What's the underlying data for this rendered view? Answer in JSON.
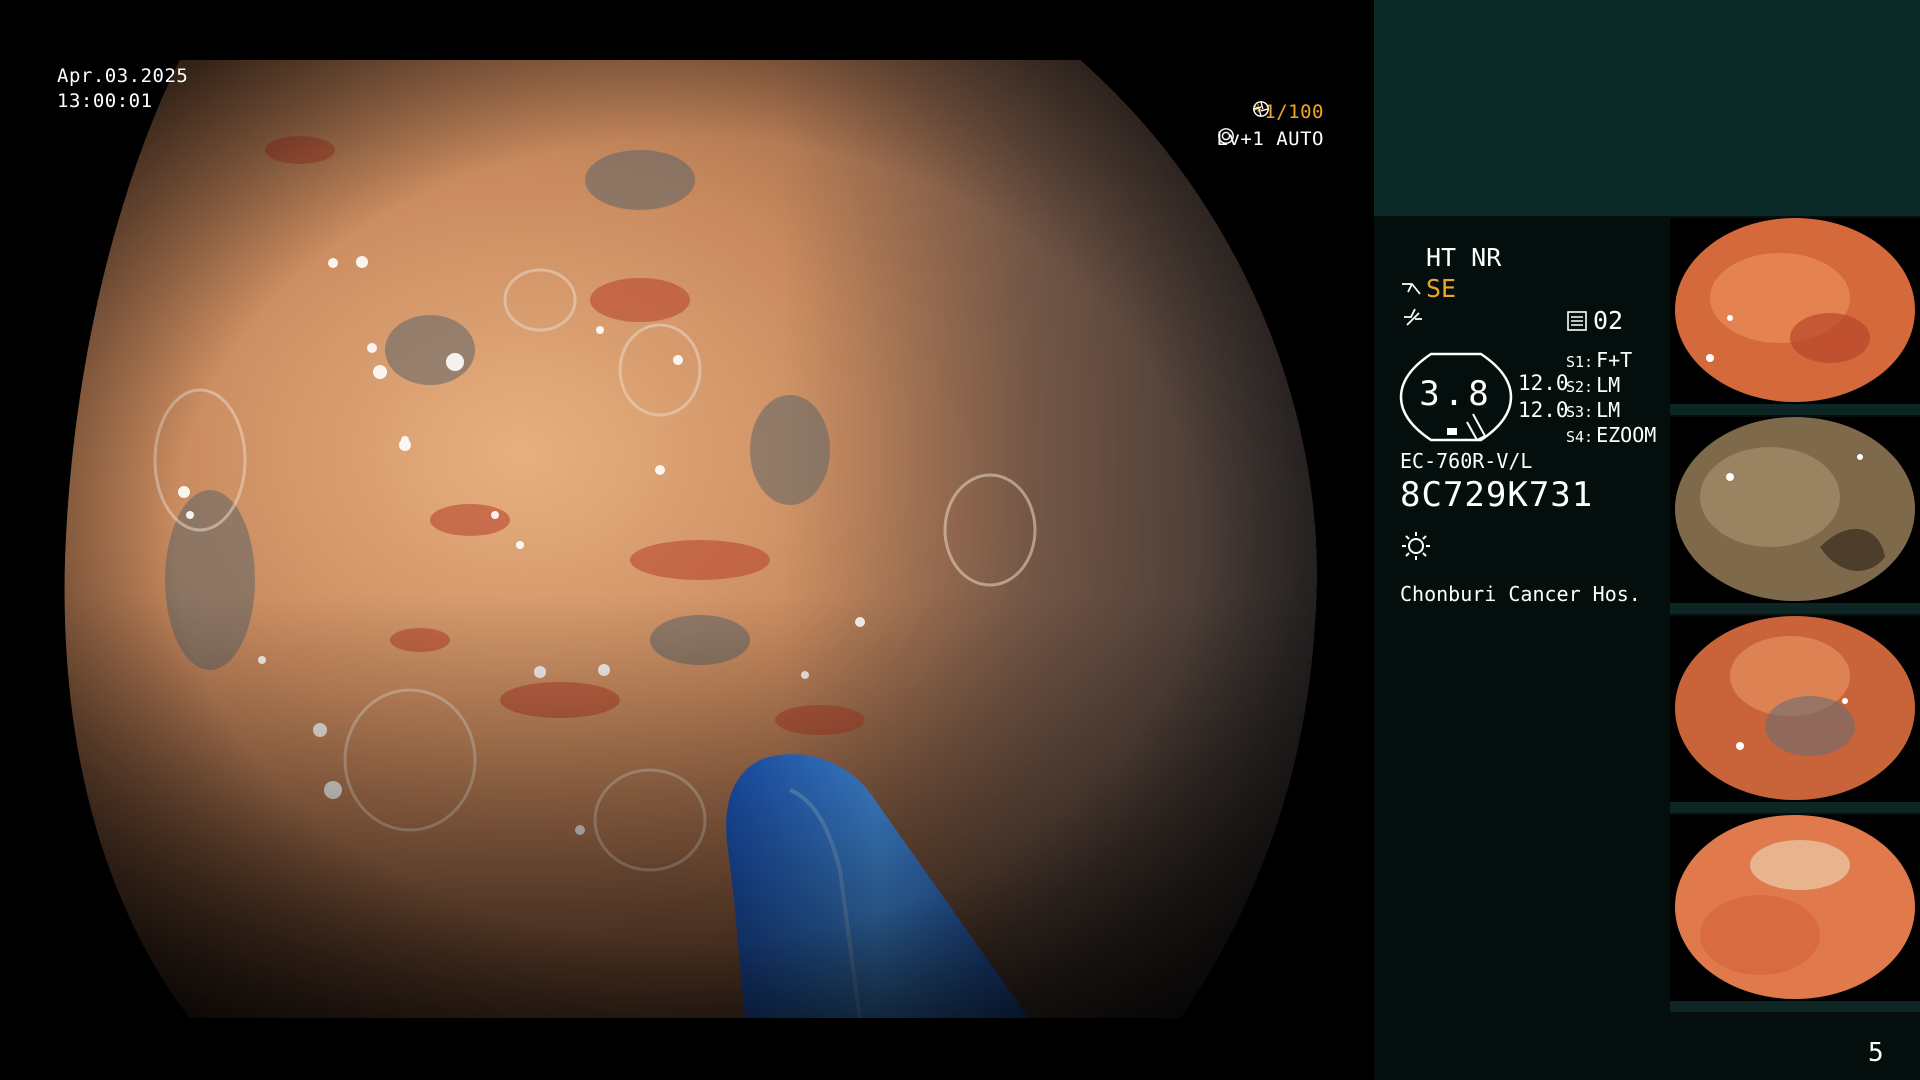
{
  "overlay": {
    "date": "Apr.03.2025",
    "time": "13:00:01",
    "shutter": "*1/100",
    "level": "Lv+1 AUTO"
  },
  "panel": {
    "ht_nr": "HT NR",
    "se": "SE",
    "memory": "02",
    "gauge_value": "3.8",
    "value_1": "12.0",
    "value_2": "12.0",
    "switches": [
      {
        "key": "S1:",
        "value": "F+T"
      },
      {
        "key": "S2:",
        "value": "LM"
      },
      {
        "key": "S3:",
        "value": "LM"
      },
      {
        "key": "S4:",
        "value": "EZOOM"
      }
    ],
    "scope_model": "EC-760R-V/L",
    "serial": "8C729K731",
    "hospital": "Chonburi Cancer Hos.",
    "page_number": "5"
  },
  "icons": {
    "shutter": "aperture-icon",
    "level": "iris-icon",
    "se": "scissors-icon",
    "curve": "curve-icon",
    "memory": "memory-card-icon",
    "light": "sun-icon"
  },
  "colors": {
    "accent": "#f0a528",
    "panel_top": "#0a2b28",
    "panel_bg": "#040f0d",
    "text": "#ffffff",
    "instrument": "#2f7de8"
  },
  "thumbnails": [
    {
      "name": "thumb-1"
    },
    {
      "name": "thumb-2"
    },
    {
      "name": "thumb-3"
    },
    {
      "name": "thumb-4"
    }
  ]
}
